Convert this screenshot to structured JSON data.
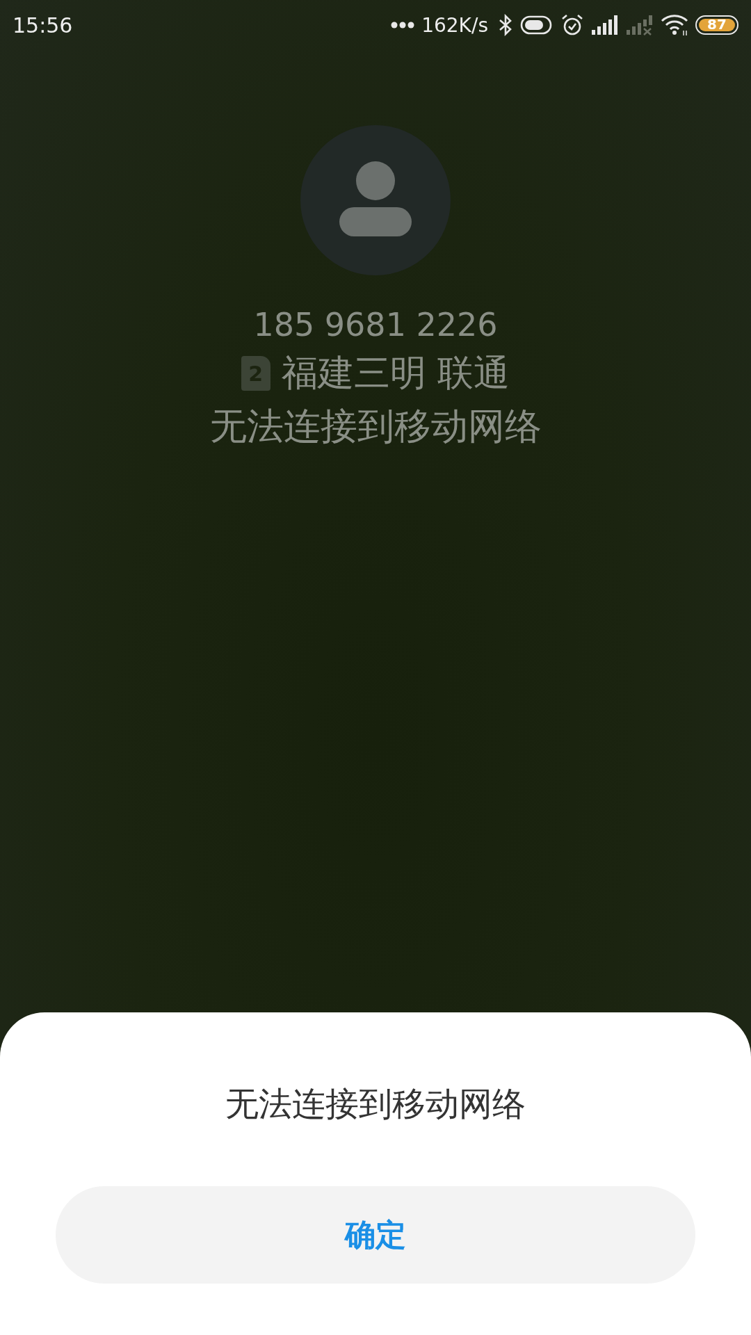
{
  "status_bar": {
    "time": "15:56",
    "net_speed": "162K/s",
    "battery": {
      "text": "87"
    }
  },
  "caller": {
    "number": "185 9681 2226",
    "sim": "2",
    "location": "福建三明 联通",
    "status": "无法连接到移动网络"
  },
  "dialog": {
    "message": "无法连接到移动网络",
    "buttons": [
      "确定"
    ]
  }
}
